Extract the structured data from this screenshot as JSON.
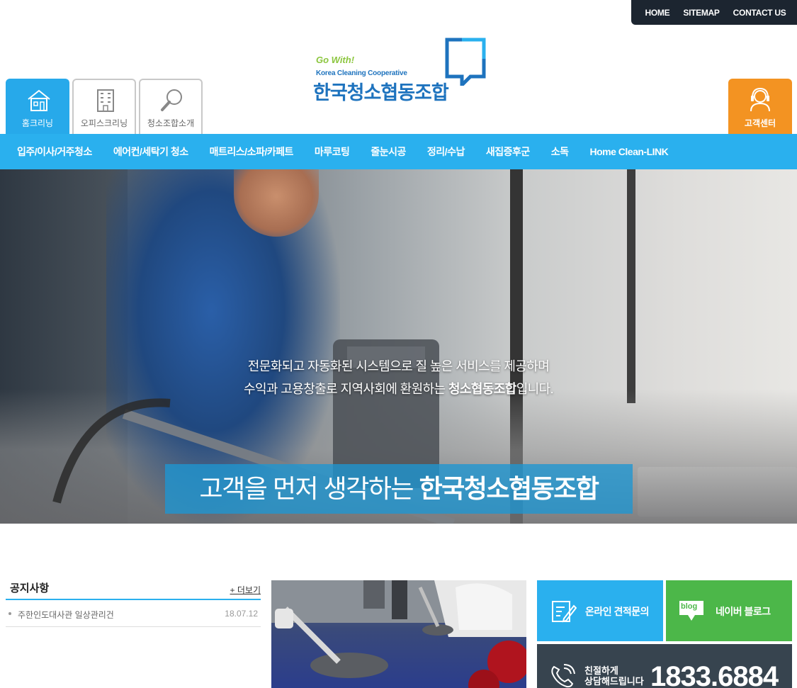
{
  "topbar": {
    "home": "HOME",
    "sitemap": "SITEMAP",
    "contact": "CONTACT US"
  },
  "logo": {
    "tagline": "Go With!",
    "english_name": "Korea Cleaning Cooperative",
    "korean_name": "한국청소협동조합"
  },
  "category_tabs": [
    {
      "label": "홈크리닝",
      "icon": "house-icon",
      "active": true
    },
    {
      "label": "오피스크리닝",
      "icon": "building-icon",
      "active": false
    },
    {
      "label": "청소조합소개",
      "icon": "magnifier-icon",
      "active": false
    }
  ],
  "customer_center": {
    "label": "고객센터",
    "icon": "headset-icon"
  },
  "main_nav": [
    "입주/이사/거주청소",
    "에어컨/세탁기 청소",
    "매트리스/소파/카페트",
    "마루코팅",
    "줄눈시공",
    "정리/수납",
    "새집증후군",
    "소독",
    "Home Clean-LINK"
  ],
  "hero": {
    "title_prefix": "고객을 먼저 생각하는 ",
    "title_strong": "한국청소협동조합",
    "line1": "전문화되고 자동화된 시스템으로 질 높은 서비스를 제공하며",
    "line2_prefix": "수익과 고용창출로 지역사회에 환원하는 ",
    "line2_strong": "청소협동조합",
    "line2_suffix": "입니다."
  },
  "notice": {
    "title": "공지사항",
    "more": "+ 더보기",
    "items": [
      {
        "text": "주한인도대사관 일상관리건",
        "date": "18.07.12"
      }
    ]
  },
  "quick": {
    "estimate": "온라인 견적문의",
    "blog": "네이버 블로그",
    "blog_badge": "blog",
    "phone_small_1": "친절하게",
    "phone_small_2": "상담해드립니다",
    "phone_number": "1833.6884"
  },
  "colors": {
    "primary": "#2ab0ee",
    "orange": "#f39322",
    "green": "#4cb749",
    "dark": "#1c2530",
    "phone_bg": "#37444f"
  }
}
